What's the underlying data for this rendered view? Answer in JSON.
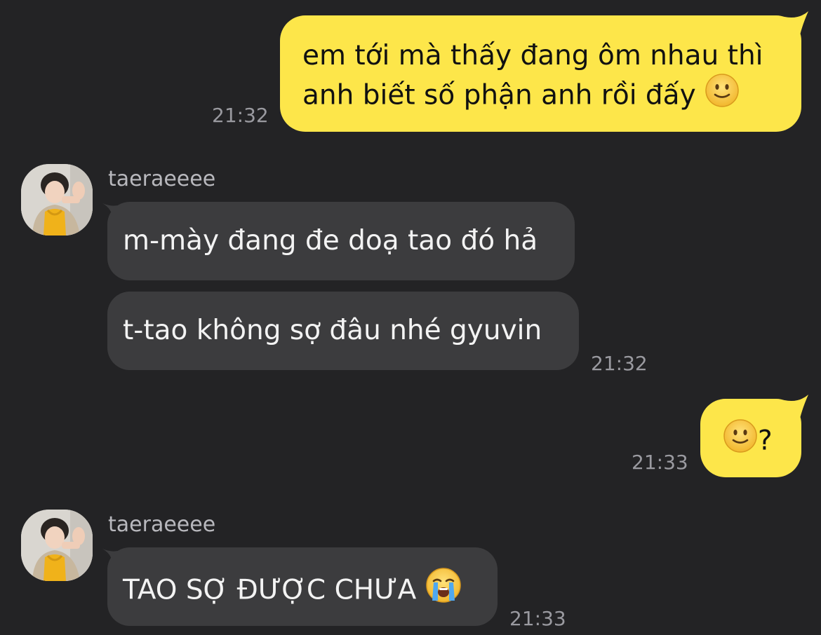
{
  "messages": [
    {
      "sender": "me",
      "lines": [
        "em tới mà thấy đang ôm nhau thì",
        "anh biết số phận anh rồi đấy"
      ],
      "emoji": "slightly-smiling-face",
      "time": "21:32"
    },
    {
      "sender": "taeraeeee",
      "name": "taeraeeee",
      "texts": [
        "m-mày đang đe doạ tao đó hả",
        "t-tao không sợ đâu nhé gyuvin"
      ],
      "time": "21:32"
    },
    {
      "sender": "me",
      "emoji": "slightly-smiling-face",
      "text": "?",
      "time": "21:33"
    },
    {
      "sender": "taeraeeee",
      "name": "taeraeeee",
      "text": "TAO SỢ ĐƯỢC CHƯA",
      "emoji": "loudly-crying-face",
      "time": "21:33"
    }
  ],
  "colors": {
    "background": "#232325",
    "my_bubble": "#FDE64A",
    "their_bubble": "#3C3C3E",
    "timestamp": "#9A9AA0",
    "name": "#B8B8BD"
  }
}
